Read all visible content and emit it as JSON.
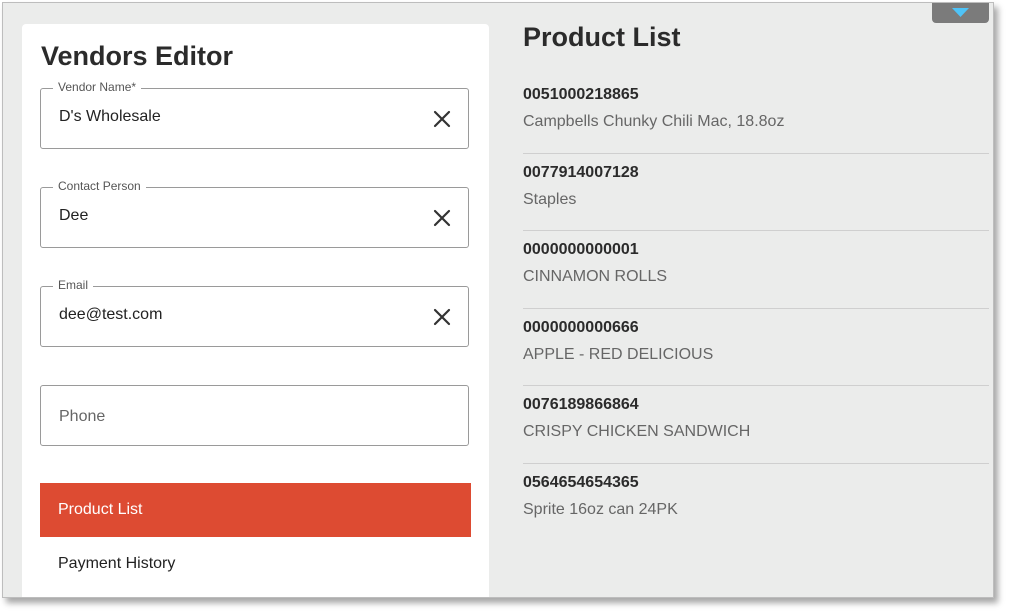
{
  "editor": {
    "title": "Vendors Editor",
    "fields": [
      {
        "label": "Vendor Name*",
        "value": "D's Wholesale",
        "clear_icon": "close-icon"
      },
      {
        "label": "Contact Person",
        "value": "Dee",
        "clear_icon": "close-icon"
      },
      {
        "label": "Email",
        "value": "dee@test.com",
        "clear_icon": "close-icon"
      },
      {
        "placeholder": "Phone"
      }
    ],
    "tabs": [
      {
        "label": "Product List",
        "active": true
      },
      {
        "label": "Payment History",
        "active": false
      }
    ],
    "accent_color": "#dd4b32"
  },
  "product_list": {
    "title": "Product List",
    "items": [
      {
        "code": "0051000218865",
        "name": "Campbells Chunky Chili Mac, 18.8oz"
      },
      {
        "code": "0077914007128",
        "name": "Staples"
      },
      {
        "code": "0000000000001",
        "name": "CINNAMON ROLLS"
      },
      {
        "code": "0000000000666",
        "name": "APPLE - RED DELICIOUS"
      },
      {
        "code": "0076189866864",
        "name": "CRISPY CHICKEN SANDWICH"
      },
      {
        "code": "0564654654365",
        "name": "Sprite 16oz can 24PK"
      }
    ]
  },
  "collapse_button": {
    "icon": "caret-down-icon",
    "icon_color": "#4fc3f7"
  }
}
